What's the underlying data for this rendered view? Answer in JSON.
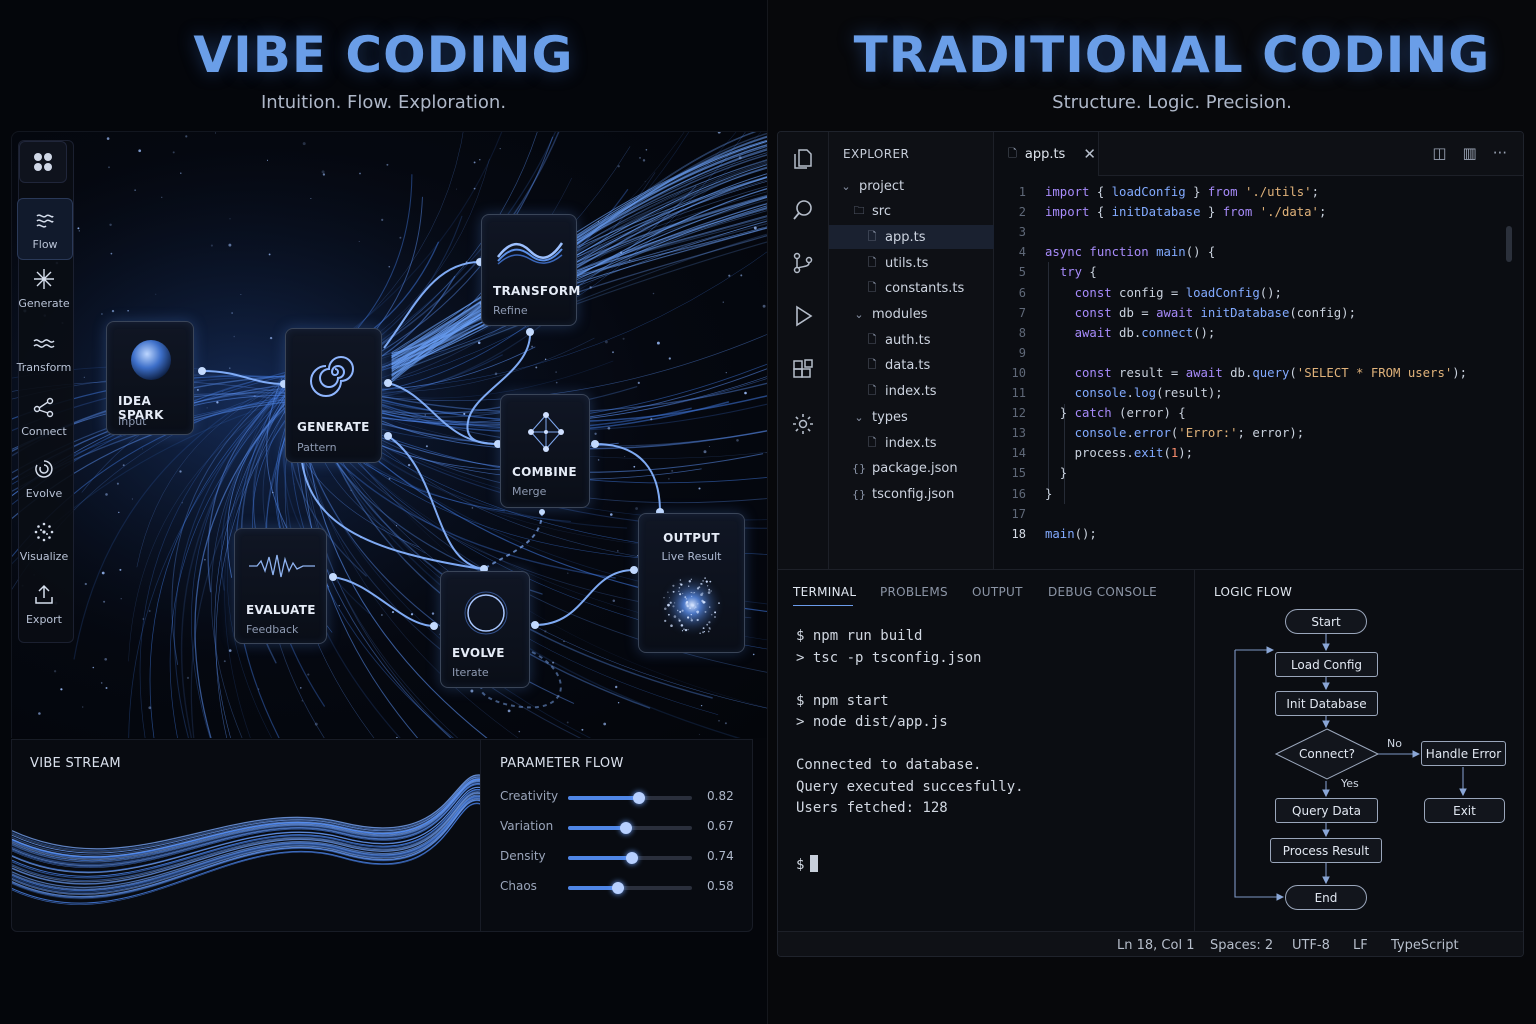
{
  "vibe": {
    "title": "VIBE CODING",
    "subtitle": "Intuition. Flow. Exploration.",
    "rail": [
      {
        "label": "Flow",
        "icon": "flow-icon",
        "active": true
      },
      {
        "label": "Generate",
        "icon": "sparkle-icon"
      },
      {
        "label": "Transform",
        "icon": "wave-icon"
      },
      {
        "label": "Connect",
        "icon": "connect-icon"
      },
      {
        "label": "Evolve",
        "icon": "evolve-icon"
      },
      {
        "label": "Visualize",
        "icon": "visualize-icon"
      },
      {
        "label": "Export",
        "icon": "export-icon"
      }
    ],
    "nodes": {
      "idea": {
        "title": "IDEA SPARK",
        "sub": "Input"
      },
      "generate": {
        "title": "GENERATE",
        "sub": "Pattern"
      },
      "transform": {
        "title": "TRANSFORM",
        "sub": "Refine"
      },
      "combine": {
        "title": "COMBINE",
        "sub": "Merge"
      },
      "evaluate": {
        "title": "EVALUATE",
        "sub": "Feedback"
      },
      "evolve": {
        "title": "EVOLVE",
        "sub": "Iterate"
      },
      "output": {
        "title": "OUTPUT",
        "sub": "Live Result"
      }
    },
    "stream_title": "VIBE STREAM",
    "param_title": "PARAMETER FLOW",
    "params": [
      {
        "label": "Creativity",
        "value": 0.82,
        "display": "0.82"
      },
      {
        "label": "Variation",
        "value": 0.67,
        "display": "0.67"
      },
      {
        "label": "Density",
        "value": 0.74,
        "display": "0.74"
      },
      {
        "label": "Chaos",
        "value": 0.58,
        "display": "0.58"
      }
    ],
    "accent": "#6a9ee8"
  },
  "trad": {
    "title": "TRADITIONAL CODING",
    "subtitle": "Structure. Logic. Precision.",
    "explorer_title": "EXPLORER",
    "tree": [
      {
        "label": "project",
        "glyph": "⌄",
        "indent": 0
      },
      {
        "label": "src",
        "glyph": "🗀",
        "indent": 1
      },
      {
        "label": "app.ts",
        "glyph": "🗋",
        "indent": 2,
        "selected": true
      },
      {
        "label": "utils.ts",
        "glyph": "🗋",
        "indent": 2
      },
      {
        "label": "constants.ts",
        "glyph": "🗋",
        "indent": 2
      },
      {
        "label": "modules",
        "glyph": "⌄",
        "indent": 1
      },
      {
        "label": "auth.ts",
        "glyph": "🗋",
        "indent": 2
      },
      {
        "label": "data.ts",
        "glyph": "🗋",
        "indent": 2
      },
      {
        "label": "index.ts",
        "glyph": "🗋",
        "indent": 2
      },
      {
        "label": "types",
        "glyph": "⌄",
        "indent": 1
      },
      {
        "label": "index.ts",
        "glyph": "🗋",
        "indent": 2
      },
      {
        "label": "package.json",
        "glyph": "{}",
        "indent": 1
      },
      {
        "label": "tsconfig.json",
        "glyph": "{}",
        "indent": 1
      }
    ],
    "tab_label": "app.ts",
    "code": [
      [
        [
          "kw",
          "import"
        ],
        [
          "plain",
          " { "
        ],
        [
          "fn",
          "loadConfig"
        ],
        [
          "plain",
          " } "
        ],
        [
          "kw",
          "from"
        ],
        [
          "plain",
          " "
        ],
        [
          "str",
          "'./utils'"
        ],
        [
          "plain",
          ";"
        ]
      ],
      [
        [
          "kw",
          "import"
        ],
        [
          "plain",
          " { "
        ],
        [
          "fn",
          "initDatabase"
        ],
        [
          "plain",
          " } "
        ],
        [
          "kw",
          "from"
        ],
        [
          "plain",
          " "
        ],
        [
          "str",
          "'./data'"
        ],
        [
          "plain",
          ";"
        ]
      ],
      [],
      [
        [
          "kw",
          "async function"
        ],
        [
          "plain",
          " "
        ],
        [
          "fn",
          "main"
        ],
        [
          "plain",
          "() {"
        ]
      ],
      [
        [
          "plain",
          "  "
        ],
        [
          "kw",
          "try"
        ],
        [
          "plain",
          " {"
        ]
      ],
      [
        [
          "plain",
          "    "
        ],
        [
          "kw",
          "const"
        ],
        [
          "plain",
          " config = "
        ],
        [
          "fn",
          "loadConfig"
        ],
        [
          "plain",
          "();"
        ]
      ],
      [
        [
          "plain",
          "    "
        ],
        [
          "kw",
          "const"
        ],
        [
          "plain",
          " db = "
        ],
        [
          "kw",
          "await"
        ],
        [
          "plain",
          " "
        ],
        [
          "fn",
          "initDatabase"
        ],
        [
          "plain",
          "(config);"
        ]
      ],
      [
        [
          "plain",
          "    "
        ],
        [
          "kw",
          "await"
        ],
        [
          "plain",
          " db."
        ],
        [
          "fn",
          "connect"
        ],
        [
          "plain",
          "();"
        ]
      ],
      [],
      [
        [
          "plain",
          "    "
        ],
        [
          "kw",
          "const"
        ],
        [
          "plain",
          " result = "
        ],
        [
          "kw",
          "await"
        ],
        [
          "plain",
          " db."
        ],
        [
          "fn",
          "query"
        ],
        [
          "plain",
          "("
        ],
        [
          "str",
          "'SELECT * FROM users'"
        ],
        [
          "plain",
          ");"
        ]
      ],
      [
        [
          "plain",
          "    "
        ],
        [
          "fn",
          "console"
        ],
        [
          "plain",
          "."
        ],
        [
          "fn",
          "log"
        ],
        [
          "plain",
          "(result);"
        ]
      ],
      [
        [
          "plain",
          "  } "
        ],
        [
          "kw",
          "catch"
        ],
        [
          "plain",
          " (error) {"
        ]
      ],
      [
        [
          "plain",
          "    "
        ],
        [
          "fn",
          "console"
        ],
        [
          "plain",
          "."
        ],
        [
          "fn",
          "error"
        ],
        [
          "plain",
          "("
        ],
        [
          "str",
          "'Error:'"
        ],
        [
          "plain",
          "; error);"
        ]
      ],
      [
        [
          "plain",
          "    process."
        ],
        [
          "fn",
          "exit"
        ],
        [
          "plain",
          "("
        ],
        [
          "num",
          "1"
        ],
        [
          "plain",
          ");"
        ]
      ],
      [
        [
          "plain",
          "  }"
        ]
      ],
      [
        [
          "plain",
          "}"
        ]
      ],
      [],
      [
        [
          "fn",
          "main"
        ],
        [
          "plain",
          "();"
        ]
      ]
    ],
    "terminal_tabs": [
      "TERMINAL",
      "PROBLEMS",
      "OUTPUT",
      "DEBUG CONSOLE"
    ],
    "terminal_lines": [
      "$ npm run build",
      "> tsc -p tsconfig.json",
      "",
      "$ npm start",
      "> node dist/app.js",
      "",
      "Connected to database.",
      "Query executed succesfully.",
      "Users fetched: 128",
      "",
      "$"
    ],
    "flow_title": "LOGIC FLOW",
    "flow": {
      "start": "Start",
      "load": "Load Config",
      "init": "Init Database",
      "connect": "Connect?",
      "query": "Query Data",
      "process": "Process Result",
      "end": "End",
      "error": "Handle Error",
      "exit": "Exit",
      "no": "No",
      "yes": "Yes"
    },
    "status": {
      "pos": "Ln 18, Col 1",
      "spaces": "Spaces: 2",
      "enc": "UTF-8",
      "eol": "LF",
      "lang": "TypeScript"
    }
  }
}
